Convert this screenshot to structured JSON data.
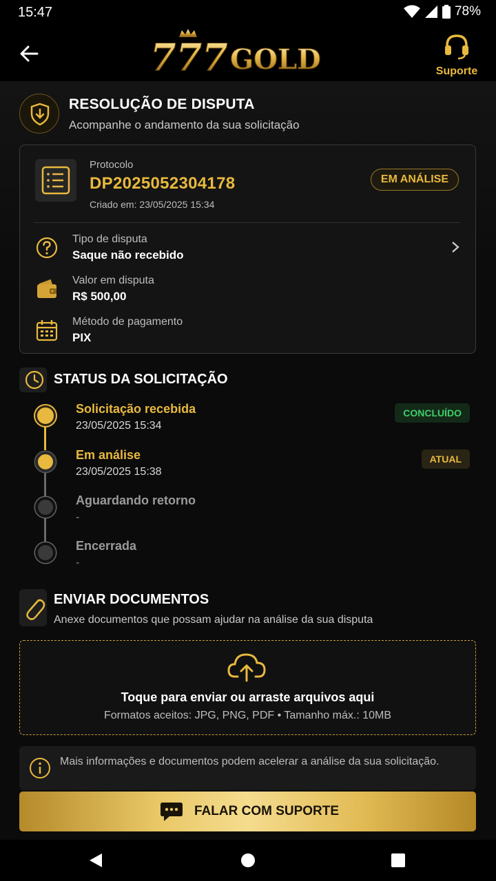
{
  "status_bar": {
    "time": "15:47",
    "battery": "78%"
  },
  "app_bar": {
    "logo_text_number": "777",
    "logo_text_word": "GOLD",
    "support_label": "Suporte"
  },
  "header": {
    "title": "RESOLUÇÃO DE DISPUTA",
    "subtitle": "Acompanhe o andamento da sua solicitação"
  },
  "protocol_card": {
    "label": "Protocolo",
    "number": "DP2025052304178",
    "created": "Criado em: 23/05/2025 15:34",
    "status_badge": "EM ANÁLISE",
    "rows": [
      {
        "label": "Tipo de disputa",
        "value": "Saque não recebido",
        "icon": "question-circle-icon"
      },
      {
        "label": "Valor em disputa",
        "value": "R$ 500,00",
        "icon": "wallet-icon"
      },
      {
        "label": "Método de pagamento",
        "value": "PIX",
        "icon": "calendar-icon"
      }
    ]
  },
  "status_section": {
    "title": "STATUS DA SOLICITAÇÃO",
    "steps": [
      {
        "title": "Solicitação recebida",
        "date": "23/05/2025 15:34",
        "badge": "CONCLUÍDO",
        "state": "done"
      },
      {
        "title": "Em análise",
        "date": "23/05/2025 15:38",
        "badge": "ATUAL",
        "state": "current"
      },
      {
        "title": "Aguardando retorno",
        "date": "-",
        "state": "pending"
      },
      {
        "title": "Encerrada",
        "date": "-",
        "state": "pending"
      }
    ]
  },
  "documents_section": {
    "title": "ENVIAR DOCUMENTOS",
    "subtitle": "Anexe documentos que possam ajudar na análise da sua disputa",
    "upload_title": "Toque para enviar ou arraste arquivos aqui",
    "upload_formats": "Formatos aceitos: JPG, PNG, PDF • Tamanho máx.: 10MB"
  },
  "info_box": {
    "text": "Mais informações e documentos podem acelerar a análise da sua solicitação."
  },
  "cta": {
    "label": "FALAR COM SUPORTE"
  },
  "colors": {
    "gold": "#e8b93e",
    "success": "#3ecf6a",
    "background": "#0b0b0b"
  }
}
